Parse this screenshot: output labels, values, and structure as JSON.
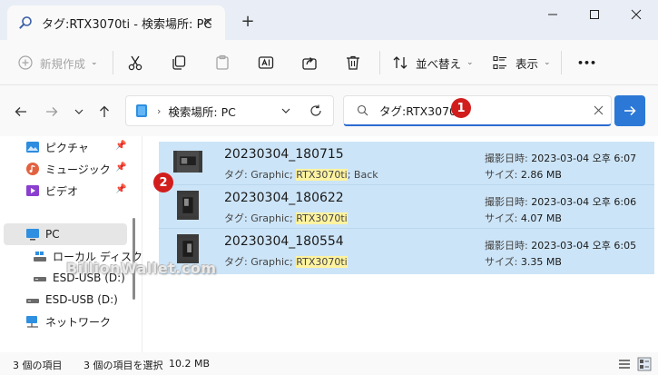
{
  "window": {
    "tab_title": "タグ:RTX3070ti - 検索場所: PC",
    "tab_close": "✕",
    "new_tab": "+"
  },
  "toolbar": {
    "new_label": "新規作成",
    "sort_label": "並べ替え",
    "view_label": "表示",
    "more_label": "•••"
  },
  "nav": {
    "address_text": "検索場所: PC",
    "search_query": "タグ:RTX3070ti"
  },
  "annotations": {
    "badge1": "1",
    "badge2": "2"
  },
  "sidebar": {
    "items": [
      {
        "label": "ピクチャ"
      },
      {
        "label": "ミュージック"
      },
      {
        "label": "ビデオ"
      },
      {
        "label": "PC"
      },
      {
        "label": "ローカル ディスク (C"
      },
      {
        "label": "ESD-USB (D:)"
      },
      {
        "label": "ESD-USB (D:)"
      },
      {
        "label": "ネットワーク"
      }
    ]
  },
  "files": [
    {
      "name": "20230304_180715",
      "tags_prefix": "タグ: Graphic; ",
      "tags_highlight": "RTX3070ti",
      "tags_suffix": "; Back",
      "date_label": "撮影日時:",
      "date_value": "2023-03-04 오후 6:07",
      "size_label": "サイズ:",
      "size_value": "2.86 MB"
    },
    {
      "name": "20230304_180622",
      "tags_prefix": "タグ: Graphic; ",
      "tags_highlight": "RTX3070ti",
      "tags_suffix": "",
      "date_label": "撮影日時:",
      "date_value": "2023-03-04 오후 6:06",
      "size_label": "サイズ:",
      "size_value": "4.07 MB"
    },
    {
      "name": "20230304_180554",
      "tags_prefix": "タグ: Graphic; ",
      "tags_highlight": "RTX3070ti",
      "tags_suffix": "",
      "date_label": "撮影日時:",
      "date_value": "2023-03-04 오후 6:05",
      "size_label": "サイズ:",
      "size_value": "3.35 MB"
    }
  ],
  "status": {
    "count": "3 個の項目",
    "selected": "3 個の項目を選択",
    "size": "10.2 MB"
  },
  "watermark": "BillionWallet.com"
}
